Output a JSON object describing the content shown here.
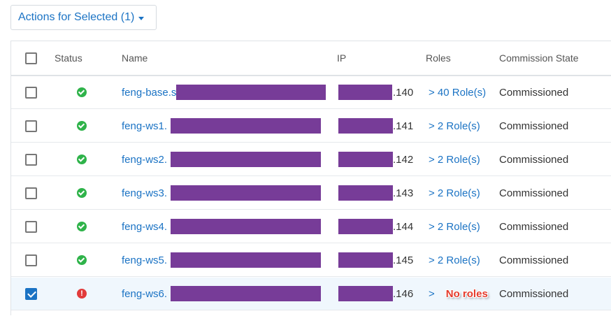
{
  "toolbar": {
    "actions_label": "Actions for Selected (1)"
  },
  "table": {
    "columns": [
      "Status",
      "Name",
      "IP",
      "Roles",
      "Commission State"
    ],
    "rows": [
      {
        "selected": false,
        "status": "ok",
        "name": "feng-base.s",
        "ip_suffix": ".140",
        "roles": "> 40 Role(s)",
        "state": "Commissioned"
      },
      {
        "selected": false,
        "status": "ok",
        "name": "feng-ws1.",
        "ip_suffix": ".141",
        "roles": "> 2 Role(s)",
        "state": "Commissioned"
      },
      {
        "selected": false,
        "status": "ok",
        "name": "feng-ws2.",
        "ip_suffix": ".142",
        "roles": "> 2 Role(s)",
        "state": "Commissioned"
      },
      {
        "selected": false,
        "status": "ok",
        "name": "feng-ws3.",
        "ip_suffix": ".143",
        "roles": "> 2 Role(s)",
        "state": "Commissioned"
      },
      {
        "selected": false,
        "status": "ok",
        "name": "feng-ws4.",
        "ip_suffix": ".144",
        "roles": "> 2 Role(s)",
        "state": "Commissioned"
      },
      {
        "selected": false,
        "status": "ok",
        "name": "feng-ws5.",
        "ip_suffix": ".145",
        "roles": "> 2 Role(s)",
        "state": "Commissioned"
      },
      {
        "selected": true,
        "status": "error",
        "name": "feng-ws6.",
        "ip_suffix": ".146",
        "roles": ">",
        "roles_annotation": "No roles",
        "state": "Commissioned"
      }
    ]
  },
  "colors": {
    "link": "#1b73c4",
    "ok": "#2fb34a",
    "error": "#e23b3b",
    "redaction": "#773c98"
  },
  "icons": {
    "ok": "check-circle-icon",
    "error": "exclamation-circle-icon",
    "dropdown": "caret-down-icon"
  }
}
